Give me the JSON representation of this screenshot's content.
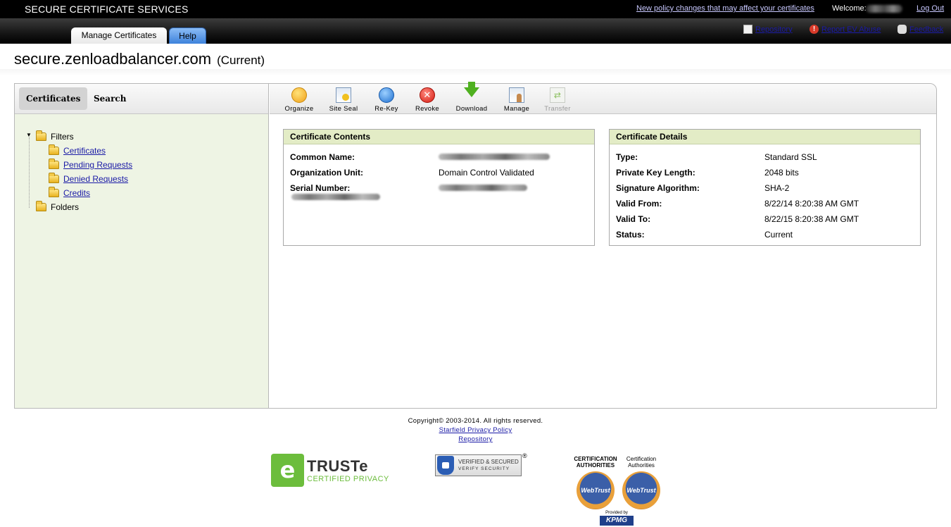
{
  "topbar": {
    "brand": "SECURE CERTIFICATE SERVICES",
    "policy_link": "New policy changes that may affect your certificates",
    "welcome": "Welcome:",
    "logout": "Log Out"
  },
  "nav": {
    "tabs": [
      {
        "label": "Manage Certificates",
        "active": true
      },
      {
        "label": "Help",
        "active": false
      }
    ],
    "links": {
      "repository": "Repository",
      "report": "Report EV Abuse",
      "feedback": "Feedback"
    }
  },
  "page": {
    "title": "secure.zenloadbalancer.com",
    "status": "(Current)"
  },
  "left": {
    "tabs": [
      "Certificates",
      "Search"
    ],
    "tree": {
      "root": "Filters",
      "children": [
        "Certificates",
        "Pending Requests",
        "Denied Requests",
        "Credits"
      ],
      "folders": "Folders"
    }
  },
  "toolbar": {
    "organize": "Organize",
    "site_seal": "Site Seal",
    "rekey": "Re-Key",
    "revoke": "Revoke",
    "download": "Download",
    "manage": "Manage",
    "transfer": "Transfer"
  },
  "contents": {
    "title": "Certificate Contents",
    "common_name_label": "Common Name:",
    "org_unit_label": "Organization Unit:",
    "org_unit_value": "Domain Control Validated",
    "serial_label": "Serial Number:"
  },
  "details": {
    "title": "Certificate Details",
    "rows": [
      {
        "label": "Type:",
        "value": "Standard SSL"
      },
      {
        "label": "Private Key Length:",
        "value": "2048 bits"
      },
      {
        "label": "Signature Algorithm:",
        "value": "SHA-2"
      },
      {
        "label": "Valid From:",
        "value": "8/22/14 8:20:38 AM GMT"
      },
      {
        "label": "Valid To:",
        "value": "8/22/15 8:20:38 AM GMT"
      },
      {
        "label": "Status:",
        "value": "Current"
      }
    ]
  },
  "footer": {
    "copyright": "Copyright© 2003-2014. All rights reserved.",
    "privacy": "Starfield Privacy Policy",
    "repository": "Repository",
    "truste_name": "TRUSTe",
    "truste_sub": "CERTIFIED PRIVACY",
    "verified_1": "VERIFIED & SECURED",
    "verified_2": "VERIFY SECURITY",
    "reg_mark": "®",
    "webtrust_1_title": "CERTIFICATION AUTHORITIES",
    "webtrust_2_title": "Certification Authorities",
    "webtrust_seal": "WebTrust",
    "provided_by": "Provided by",
    "kpmg": "KPMG"
  }
}
